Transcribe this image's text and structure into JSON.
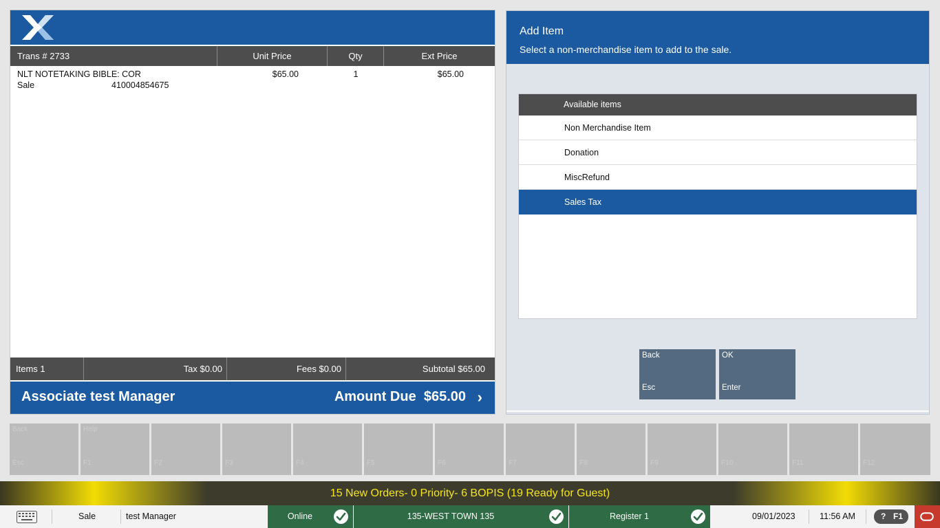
{
  "transaction": {
    "header": {
      "trans_label": "Trans #",
      "trans_number": "2733",
      "unit_price": "Unit Price",
      "qty": "Qty",
      "ext_price": "Ext Price"
    },
    "line_items": [
      {
        "description": "NLT NOTETAKING BIBLE: COR",
        "type": "Sale",
        "sku": "410004854675",
        "unit_price": "$65.00",
        "qty": "1",
        "ext_price": "$65.00"
      }
    ],
    "totals": {
      "items": "Items 1",
      "tax": "Tax $0.00",
      "fees": "Fees $0.00",
      "subtotal": "Subtotal $65.00"
    },
    "associate": "Associate test Manager",
    "amount_due": "Amount Due  $65.00",
    "amount_chevron": "›"
  },
  "add_item": {
    "title": "Add Item",
    "subtitle": "Select a non-merchandise item to add to the sale.",
    "list_header": "Available items",
    "items": [
      {
        "label": "Non Merchandise Item",
        "selected": false
      },
      {
        "label": "Donation",
        "selected": false
      },
      {
        "label": "MiscRefund",
        "selected": false
      },
      {
        "label": "Sales Tax",
        "selected": true
      }
    ],
    "buttons": {
      "back": {
        "label": "Back",
        "key": "Esc"
      },
      "ok": {
        "label": "OK",
        "key": "Enter"
      }
    }
  },
  "function_keys": [
    {
      "label": "Back",
      "key": "Esc"
    },
    {
      "label": "Help",
      "key": "F1"
    },
    {
      "label": "",
      "key": "F2"
    },
    {
      "label": "",
      "key": "F3"
    },
    {
      "label": "",
      "key": "F4"
    },
    {
      "label": "",
      "key": "F5"
    },
    {
      "label": "",
      "key": "F6"
    },
    {
      "label": "",
      "key": "F7"
    },
    {
      "label": "",
      "key": "F8"
    },
    {
      "label": "",
      "key": "F9"
    },
    {
      "label": "",
      "key": "F10"
    },
    {
      "label": "",
      "key": "F11"
    },
    {
      "label": "",
      "key": "F12"
    }
  ],
  "banner": "15 New Orders- 0 Priority- 6 BOPIS (19 Ready for Guest)",
  "status_bar": {
    "mode": "Sale",
    "user": "test Manager",
    "online": "Online",
    "store": "135-WEST TOWN 135",
    "register": "Register 1",
    "date": "09/01/2023",
    "time": "11:56 AM",
    "help_symbol": "?",
    "help_key": "F1"
  },
  "icons": {
    "logo": "x-logo-icon",
    "keyboard": "keyboard-icon",
    "status_check": "check-circle-icon",
    "oracle": "oracle-icon"
  },
  "colors": {
    "primary_blue": "#1b5aa0",
    "header_gray": "#4d4d4d",
    "button_slate": "#546a80",
    "status_green": "#2f6b45",
    "banner_yellow": "#f5e61c",
    "oracle_red": "#c6392c"
  }
}
